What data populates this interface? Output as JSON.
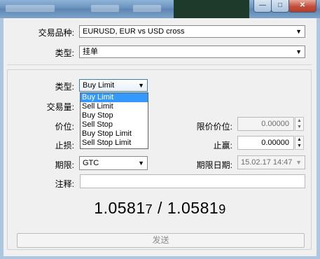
{
  "titlebar": {
    "minimize": "—",
    "maximize": "□",
    "close": "✕"
  },
  "form": {
    "symbol_label": "交易品种:",
    "symbol_value": "EURUSD, EUR vs USD cross",
    "type_label": "类型:",
    "type_value": "挂单"
  },
  "pending": {
    "type_label": "类型:",
    "type_value": "Buy Limit",
    "options": [
      "Buy Limit",
      "Sell Limit",
      "Buy Stop",
      "Sell Stop",
      "Buy Stop Limit",
      "Sell Stop Limit"
    ],
    "selected_index": 0,
    "volume_label": "交易量:",
    "price_label": "价位:",
    "stop_loss_label": "止损:",
    "limit_price_label": "限价价位:",
    "limit_price_value": "0.00000",
    "take_profit_label": "止赢:",
    "take_profit_value": "0.00000",
    "expiration_label": "期限:",
    "expiration_value": "GTC",
    "expiration_date_label": "期限日期:",
    "expiration_date_value": "15.02.17 14:47",
    "comment_label": "注释:",
    "comment_value": ""
  },
  "quote": {
    "bid_main": "1.0581",
    "bid_small": "7",
    "separator": "/",
    "ask_main": "1.0581",
    "ask_small": "9"
  },
  "send_button": "发送",
  "icons": {
    "dropdown": "chevron-down-icon",
    "spin_up": "spin-up-icon",
    "spin_down": "spin-down-icon"
  }
}
